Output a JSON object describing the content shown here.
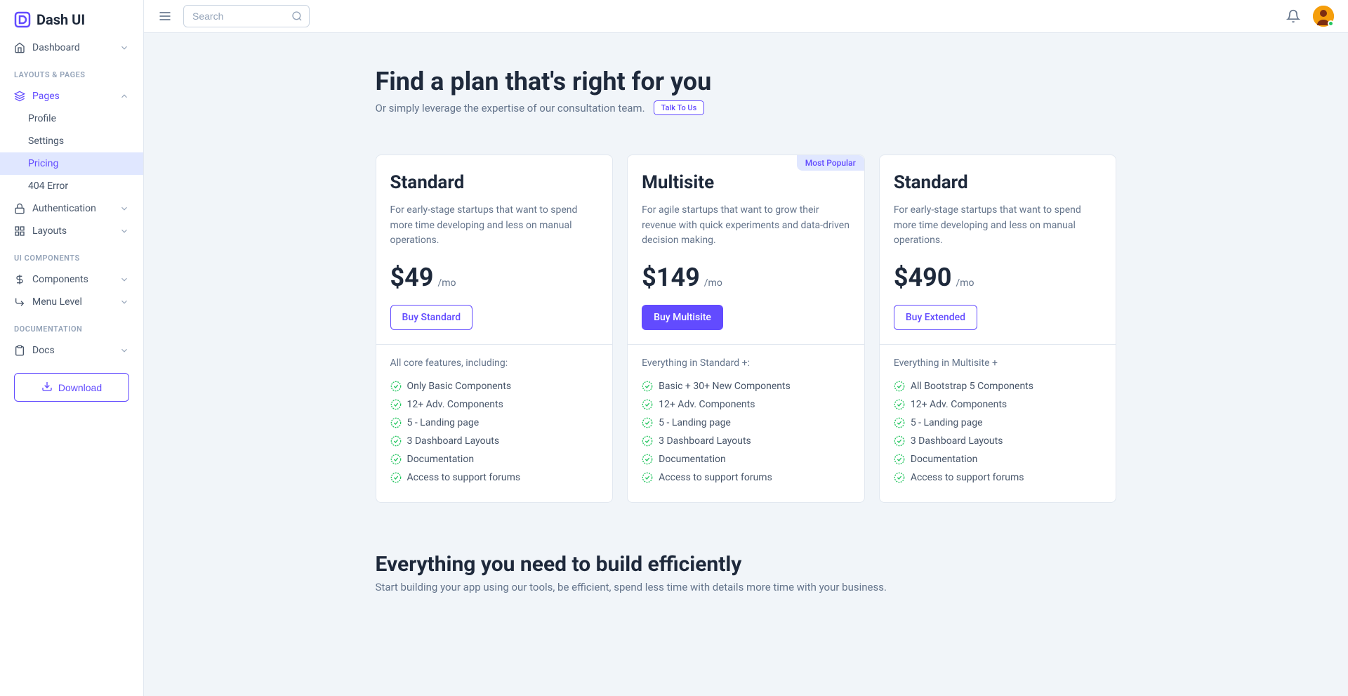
{
  "brand": {
    "name": "Dash UI"
  },
  "search": {
    "placeholder": "Search"
  },
  "sidebar": {
    "dashboard": "Dashboard",
    "sections": {
      "layouts": "LAYOUTS & PAGES",
      "ui": "UI COMPONENTS",
      "docs": "DOCUMENTATION"
    },
    "pages": {
      "label": "Pages",
      "profile": "Profile",
      "settings": "Settings",
      "pricing": "Pricing",
      "error404": "404 Error"
    },
    "authentication": "Authentication",
    "layouts_item": "Layouts",
    "components": "Components",
    "menu_level": "Menu Level",
    "docs": "Docs",
    "download": "Download"
  },
  "page": {
    "title": "Find a plan that's right for you",
    "subtitle": "Or simply leverage the expertise of our consultation team.",
    "talk_to_us": "Talk To Us"
  },
  "plans": [
    {
      "name": "Standard",
      "badge": null,
      "desc": "For early-stage startups that want to spend more time developing and less on manual operations.",
      "price": "$49",
      "period": "/mo",
      "cta": "Buy Standard",
      "cta_style": "outline",
      "features_title": "All core features, including:",
      "features": [
        "Only Basic Components",
        "12+ Adv. Components",
        "5 - Landing page",
        "3 Dashboard Layouts",
        "Documentation",
        "Access to support forums"
      ]
    },
    {
      "name": "Multisite",
      "badge": "Most Popular",
      "desc": "For agile startups that want to grow their revenue with quick experiments and data-driven decision making.",
      "price": "$149",
      "period": "/mo",
      "cta": "Buy Multisite",
      "cta_style": "solid",
      "features_title": "Everything in Standard +:",
      "features": [
        "Basic + 30+ New Components",
        "12+ Adv. Components",
        "5 - Landing page",
        "3 Dashboard Layouts",
        "Documentation",
        "Access to support forums"
      ]
    },
    {
      "name": "Standard",
      "badge": null,
      "desc": "For early-stage startups that want to spend more time developing and less on manual operations.",
      "price": "$490",
      "period": "/mo",
      "cta": "Buy Extended",
      "cta_style": "outline",
      "features_title": "Everything in Multisite +",
      "features": [
        "All Bootstrap 5 Components",
        "12+ Adv. Components",
        "5 - Landing page",
        "3 Dashboard Layouts",
        "Documentation",
        "Access to support forums"
      ]
    }
  ],
  "section2": {
    "title": "Everything you need to build efficiently",
    "desc": "Start building your app using our tools, be efficient, spend less time with details more time with your business."
  }
}
